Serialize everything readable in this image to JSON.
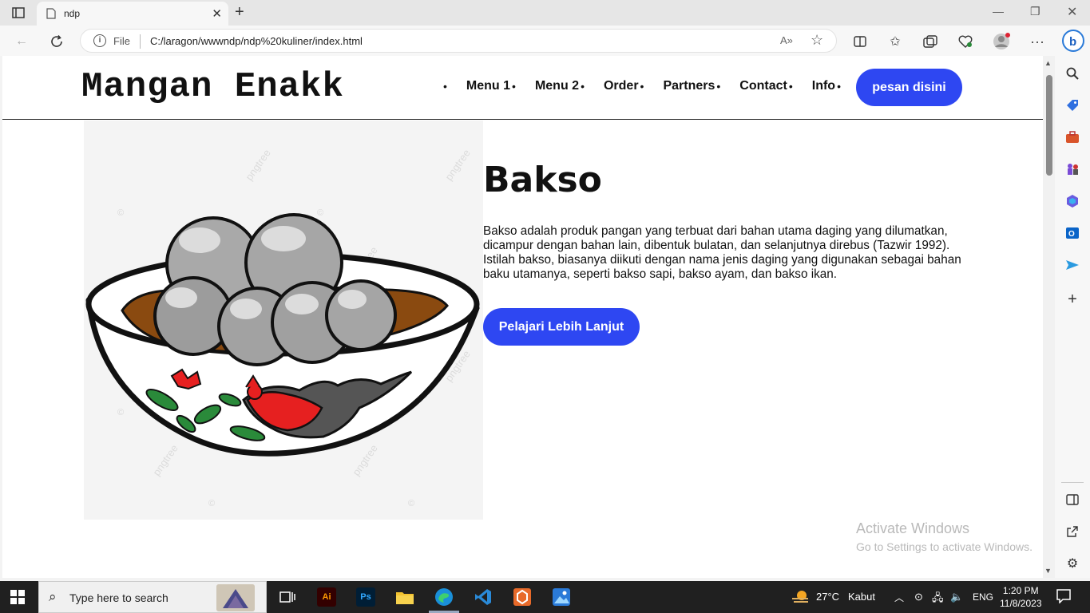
{
  "browser": {
    "tab_title": "ndp",
    "address_scheme": "File",
    "url": "C:/laragon/wwwndp/ndp%20kuliner/index.html",
    "read_aloud_label": "A»"
  },
  "site": {
    "logo": "Mangan Enakk",
    "nav": [
      "Menu 1",
      "Menu 2",
      "Order",
      "Partners",
      "Contact",
      "Info"
    ],
    "cta": "pesan disini",
    "hero": {
      "title": "Bakso",
      "text": "Bakso adalah produk pangan yang terbuat dari bahan utama daging yang dilumatkan, dicampur dengan bahan lain, dibentuk bulatan, dan selanjutnya direbus (Tazwir 1992). Istilah bakso, biasanya diikuti dengan nama jenis daging yang digunakan sebagai bahan baku utamanya, seperti bakso sapi, bakso ayam, dan bakso ikan.",
      "button": "Pelajari Lebih Lanjut",
      "image_watermark": "pngtree"
    }
  },
  "activation": {
    "line1": "Activate Windows",
    "line2": "Go to Settings to activate Windows."
  },
  "taskbar": {
    "search_placeholder": "Type here to search",
    "weather_temp": "27°C",
    "weather_desc": "Kabut",
    "language": "ENG",
    "time": "1:20 PM",
    "date": "11/8/2023"
  },
  "colors": {
    "accent": "#2e47f2"
  }
}
